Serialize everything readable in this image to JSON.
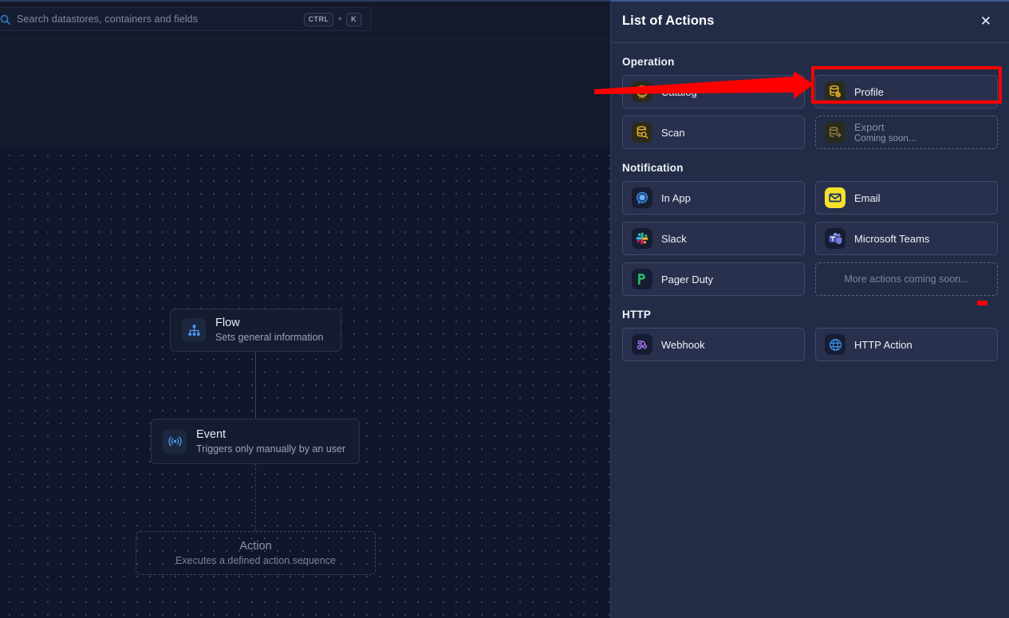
{
  "search": {
    "placeholder": "Search datastores, containers and fields",
    "shortcut_key1": "CTRL",
    "shortcut_plus": "+",
    "shortcut_key2": "K",
    "icon": "search-icon"
  },
  "flow_canvas": {
    "nodes": [
      {
        "title": "Flow",
        "subtitle": "Sets general information",
        "icon": "sitemap-icon",
        "state": "filled"
      },
      {
        "title": "Event",
        "subtitle": "Triggers only manually by an user",
        "icon": "broadcast-icon",
        "state": "filled"
      },
      {
        "title": "Action",
        "subtitle": "Executes a defined action sequence",
        "icon": "none",
        "state": "placeholder"
      }
    ]
  },
  "panel": {
    "title": "List of Actions",
    "close_label": "✕",
    "close_icon": "close-icon",
    "sections": [
      {
        "title": "Operation",
        "items": [
          {
            "label": "Catalog",
            "sub": "",
            "icon": "database-catalog-icon",
            "disabled": false,
            "highlighted": false
          },
          {
            "label": "Profile",
            "sub": "",
            "icon": "database-profile-icon",
            "disabled": false,
            "highlighted": true
          },
          {
            "label": "Scan",
            "sub": "",
            "icon": "database-scan-icon",
            "disabled": false,
            "highlighted": false
          },
          {
            "label": "Export",
            "sub": "Coming soon...",
            "icon": "database-export-icon",
            "disabled": true,
            "highlighted": false
          }
        ]
      },
      {
        "title": "Notification",
        "items": [
          {
            "label": "In App",
            "sub": "",
            "icon": "in-app-bell-icon",
            "disabled": false,
            "highlighted": false
          },
          {
            "label": "Email",
            "sub": "",
            "icon": "email-icon",
            "disabled": false,
            "highlighted": false
          },
          {
            "label": "Slack",
            "sub": "",
            "icon": "slack-icon",
            "disabled": false,
            "highlighted": false
          },
          {
            "label": "Microsoft Teams",
            "sub": "",
            "icon": "microsoft-teams-icon",
            "disabled": false,
            "highlighted": false
          },
          {
            "label": "Pager Duty",
            "sub": "",
            "icon": "pagerduty-icon",
            "disabled": false,
            "highlighted": false
          },
          {
            "label": "More actions coming soon...",
            "sub": "",
            "icon": "none",
            "disabled": true,
            "highlighted": false,
            "empty": true
          }
        ]
      },
      {
        "title": "HTTP",
        "items": [
          {
            "label": "Webhook",
            "sub": "",
            "icon": "webhook-icon",
            "disabled": false,
            "highlighted": false
          },
          {
            "label": "HTTP Action",
            "sub": "",
            "icon": "globe-icon",
            "disabled": false,
            "highlighted": false
          }
        ]
      }
    ]
  },
  "annotations": {
    "arrow_color": "#ff0000",
    "box_color": "#ff0000",
    "arrow_target": "Profile",
    "box_target": "Profile"
  },
  "colors": {
    "panel_bg": "#232c47",
    "canvas_bg": "#10172a",
    "topbar_bg": "#141a2b",
    "card_bg": "#28304d",
    "accent_yellow": "#f0b429",
    "accent_blue": "#3b82f6"
  }
}
